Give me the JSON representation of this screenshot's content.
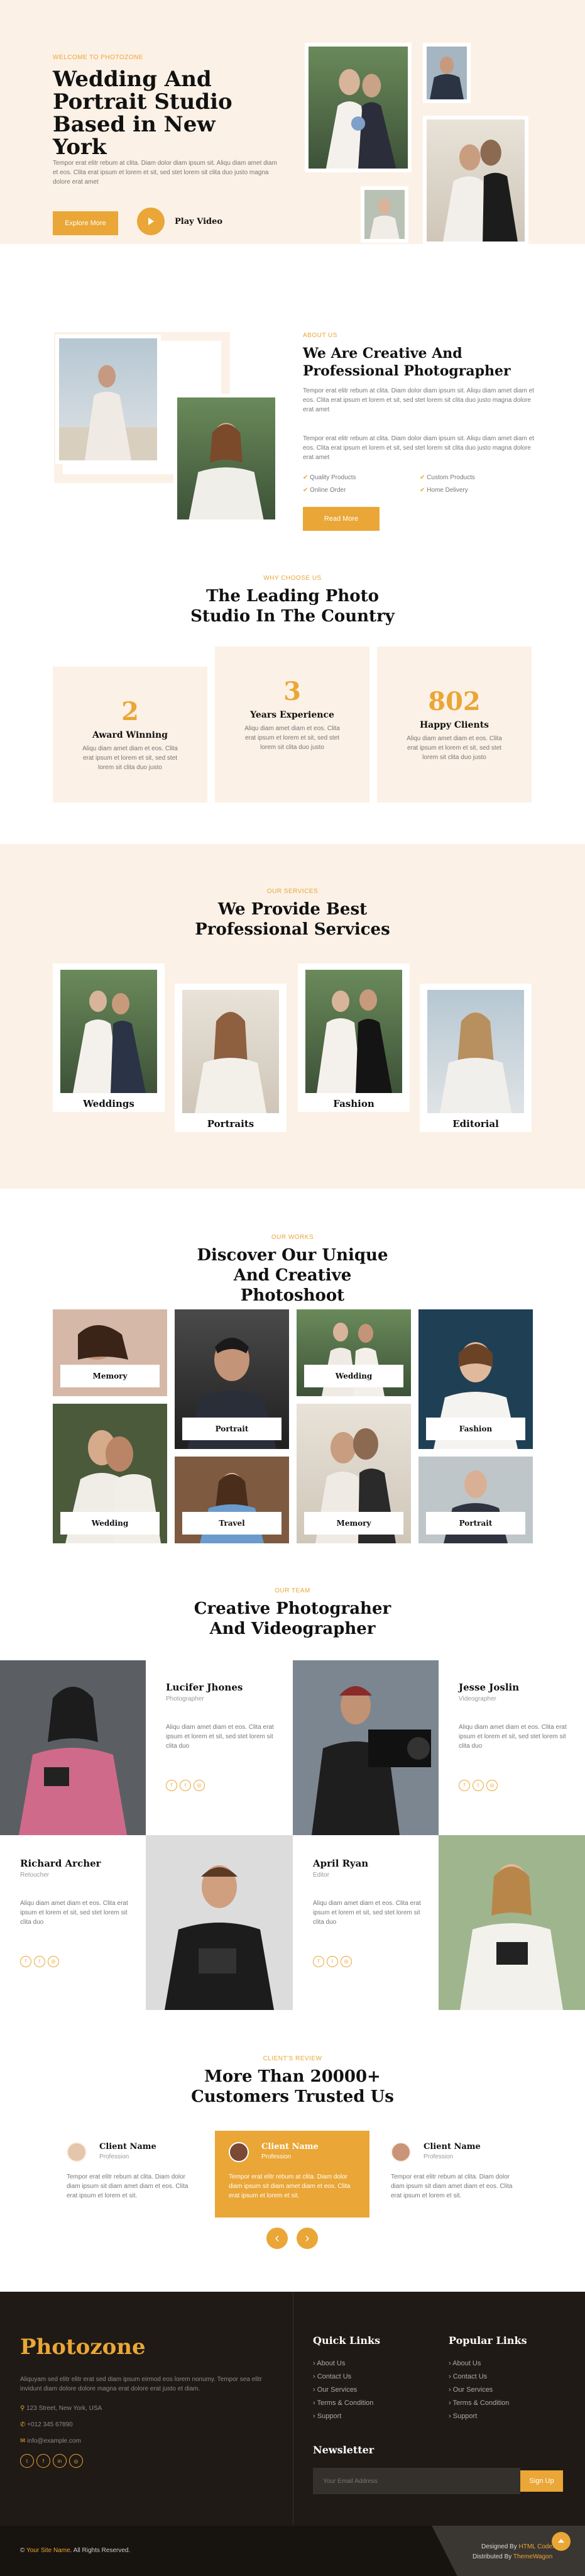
{
  "hero": {
    "subtitle": "WELCOME TO PHOTOZONE",
    "title": "Wedding And Portrait Studio Based in New York",
    "text": "Tempor erat elitr rebum at clita. Diam dolor diam ipsum sit. Aliqu diam amet diam et eos. Clita erat ipsum et lorem et sit, sed stet lorem sit clita duo justo magna dolore erat amet",
    "btn_explore": "Explore More",
    "btn_play": "Play Video"
  },
  "about": {
    "subtitle": "ABOUT US",
    "title": "We Are Creative And Professional Photographer",
    "p1": "Tempor erat elitr rebum at clita. Diam dolor diam ipsum sit. Aliqu diam amet diam et eos. Clita erat ipsum et lorem et sit, sed stet lorem sit clita duo justo magna dolore erat amet",
    "p2": "Tempor erat elitr rebum at clita. Diam dolor diam ipsum sit. Aliqu diam amet diam et eos. Clita erat ipsum et lorem et sit, sed stet lorem sit clita duo justo magna dolore erat amet",
    "checks": [
      "Quality Products",
      "Custom Products",
      "Online Order",
      "Home Delivery"
    ],
    "btn": "Read More"
  },
  "features": {
    "subtitle": "WHY CHOOSE US",
    "title": "The Leading Photo Studio In The Country",
    "items": [
      {
        "num": "2",
        "title": "Award Winning",
        "text": "Aliqu diam amet diam et eos. Clita erat ipsum et lorem et sit, sed stet lorem sit clita duo justo"
      },
      {
        "num": "3",
        "title": "Years Experience",
        "text": "Aliqu diam amet diam et eos. Clita erat ipsum et lorem et sit, sed stet lorem sit clita duo justo"
      },
      {
        "num": "802",
        "title": "Happy Clients",
        "text": "Aliqu diam amet diam et eos. Clita erat ipsum et lorem et sit, sed stet lorem sit clita duo justo"
      }
    ]
  },
  "services": {
    "subtitle": "OUR SERVICES",
    "title": "We Provide Best Professional Services",
    "items": [
      "Weddings",
      "Portraits",
      "Fashion",
      "Editorial"
    ]
  },
  "works": {
    "subtitle": "OUR WORKS",
    "title": "Discover Our Unique And Creative Photoshoot",
    "items": [
      "Memory",
      "Portrait",
      "Wedding",
      "Fashion",
      "Wedding",
      "Travel",
      "Memory",
      "Portrait"
    ]
  },
  "team": {
    "subtitle": "OUR TEAM",
    "title": "Creative Photograher And Videographer",
    "text": "Aliqu diam amet diam et eos. Clita erat ipsum et lorem et sit, sed stet lorem sit clita duo",
    "members": [
      {
        "name": "Lucifer Jhones",
        "role": "Photographer"
      },
      {
        "name": "Jesse Joslin",
        "role": "Videographer"
      },
      {
        "name": "Richard Archer",
        "role": "Retoucher"
      },
      {
        "name": "April Ryan",
        "role": "Editor"
      }
    ]
  },
  "testimonial": {
    "subtitle": "CLIENT'S REVIEW",
    "title": "More Than 20000+ Customers Trusted Us",
    "items": [
      {
        "name": "Client Name",
        "role": "Profession",
        "text": "Tempor erat elitr rebum at clita. Diam dolor diam ipsum sit diam amet diam et eos. Clita erat ipsum et lorem et sit."
      },
      {
        "name": "Client Name",
        "role": "Profession",
        "text": "Tempor erat elitr rebum at clita. Diam dolor diam ipsum sit diam amet diam et eos. Clita erat ipsum et lorem et sit."
      },
      {
        "name": "Client Name",
        "role": "Profession",
        "text": "Tempor erat elitr rebum at clita. Diam dolor diam ipsum sit diam amet diam et eos. Clita erat ipsum et lorem et sit."
      }
    ],
    "prev": "‹",
    "next": "›"
  },
  "footer": {
    "brand": "Photozone",
    "text": "Aliquyam sed elitr elitr erat sed diam ipsum eirmod eos lorem nonumy. Tempor sea elitr invidunt diam dolore dolore magna erat dolore erat justo et diam.",
    "address": "123 Street, New York, USA",
    "phone": "+012 345 67890",
    "email": "info@example.com",
    "quick_title": "Quick Links",
    "quick": [
      "About Us",
      "Contact Us",
      "Our Services",
      "Terms & Condition",
      "Support"
    ],
    "popular_title": "Popular Links",
    "popular": [
      "About Us",
      "Contact Us",
      "Our Services",
      "Terms & Condition",
      "Support"
    ],
    "newsletter_title": "Newsletter",
    "newsletter_placeholder": "Your Email Address",
    "newsletter_btn": "Sign Up",
    "copyright_name": "Your Site Name",
    "copyright_suffix": ". All Rights Reserved.",
    "designed_prefix": "Designed By ",
    "designed_by": "HTML Codex",
    "distributed_prefix": "Distributed By ",
    "distributed_by": "ThemeWagon"
  },
  "colors": {
    "accent": "#EAA636",
    "cream": "#FCF1E6",
    "dark": "#1F1A16"
  }
}
